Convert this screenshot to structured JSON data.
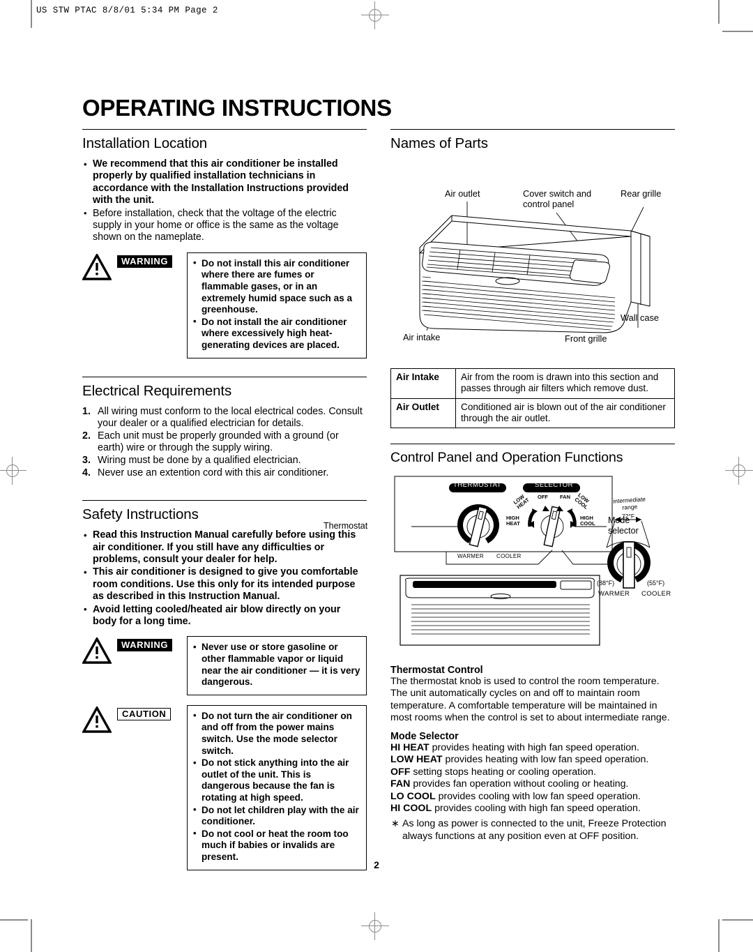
{
  "slug": "US STW PTAC  8/8/01 5:34 PM  Page 2",
  "page_number": "2",
  "title": "OPERATING INSTRUCTIONS",
  "left_column": {
    "installation": {
      "heading": "Installation Location",
      "bullets": [
        {
          "bold": true,
          "text": "We recommend that this air conditioner be installed properly by qualified installation technicians in accordance with the Installation Instructions provided with the unit."
        },
        {
          "bold": false,
          "text": "Before installation, check that the voltage of the electric supply in your home or office is the same as the voltage shown on the nameplate."
        }
      ],
      "warning": {
        "tag": "WARNING",
        "bullets": [
          "Do not install this air conditioner where there are fumes or flammable gases, or in an extremely humid space such as a greenhouse.",
          "Do not install the air conditioner where excessively high heat-generating devices are placed."
        ]
      }
    },
    "electrical": {
      "heading": "Electrical Requirements",
      "items": [
        {
          "n": "1.",
          "text": "All wiring must conform to the local electrical codes. Consult your dealer or a qualified electrician for details."
        },
        {
          "n": "2.",
          "text": "Each unit must be properly grounded with a ground (or earth) wire or through the supply wiring."
        },
        {
          "n": "3.",
          "text": "Wiring must be done by a qualified electrician."
        },
        {
          "n": "4.",
          "text": "Never use an extention cord with this air conditioner."
        }
      ]
    },
    "safety": {
      "heading": "Safety Instructions",
      "bullets": [
        "Read this Instruction Manual carefully before using this air conditioner. If you still have any difficulties or problems, consult your dealer for help.",
        "This air conditioner is designed to give you comfortable room conditions. Use this only for its intended purpose as described in this Instruction Manual.",
        "Avoid letting cooled/heated air blow directly on your body for a long time."
      ],
      "warning": {
        "tag": "WARNING",
        "bullets": [
          "Never use or store gasoline or other flammable vapor or liquid near the air conditioner — it is very dangerous."
        ]
      },
      "caution": {
        "tag": "CAUTION",
        "bullets": [
          "Do not turn the air conditioner on and off from the power mains switch. Use the mode selector switch.",
          "Do not stick anything into the air outlet of the unit. This is dangerous because the fan is rotating at high speed.",
          "Do not let children play with the air conditioner.",
          "Do not cool or heat the room too much if babies or invalids are present."
        ]
      }
    }
  },
  "right_column": {
    "names_of_parts": {
      "heading": "Names of Parts",
      "callouts": {
        "air_outlet": "Air outlet",
        "cover_switch": "Cover switch and\ncontrol panel",
        "rear_grille": "Rear grille",
        "air_intake": "Air intake",
        "front_grille": "Front grille",
        "wall_case": "Wall case"
      },
      "table": [
        {
          "key": "Air Intake",
          "desc": "Air from the room is drawn into this section and passes through air filters which remove dust."
        },
        {
          "key": "Air Outlet",
          "desc": "Conditioned air is blown out of the air conditioner through the air outlet."
        }
      ]
    },
    "control_panel": {
      "heading": "Control Panel and Operation Functions",
      "diagram": {
        "thermostat_badge": "THERMOSTAT",
        "selector_badge": "SELECTOR",
        "thermostat_label": "Thermostat",
        "mode_selector_label": "Mode\nselector",
        "warmer": "WARMER",
        "cooler": "COOLER",
        "selector_positions": [
          "LOW\nHEAT",
          "OFF",
          "FAN",
          "LOW\nCOOL",
          "HIGH\nHEAT",
          "HIGH\nCOOL"
        ],
        "detail": {
          "intermediate_range": "intermediate\nrange",
          "intermediate_temp": "72°F",
          "warmer_temp": "(88°F)",
          "cooler_temp": "(55°F)",
          "warmer": "WARMER",
          "cooler": "COOLER"
        }
      },
      "thermostat_control": {
        "heading": "Thermostat Control",
        "body": "The thermostat knob is used to control the room temperature. The unit automatically cycles on and off to maintain room temperature. A comfortable temperature will be maintained in most rooms when the control is set to about intermediate range."
      },
      "mode_selector": {
        "heading": "Mode Selector",
        "items": [
          {
            "term": "HI HEAT",
            "desc": " provides heating with high fan speed operation."
          },
          {
            "term": "LOW HEAT",
            "desc": " provides heating with low fan speed operation."
          },
          {
            "term": "OFF",
            "desc": " setting stops heating or cooling operation."
          },
          {
            "term": "FAN",
            "desc": " provides fan operation without cooling or heating."
          },
          {
            "term": "LO COOL",
            "desc": " provides cooling with low fan speed operation."
          },
          {
            "term": "HI COOL",
            "desc": " provides cooling with high fan speed operation."
          }
        ],
        "footnote": "As long as power is connected to the unit, Freeze Protection always functions at any position even at OFF position."
      }
    }
  }
}
